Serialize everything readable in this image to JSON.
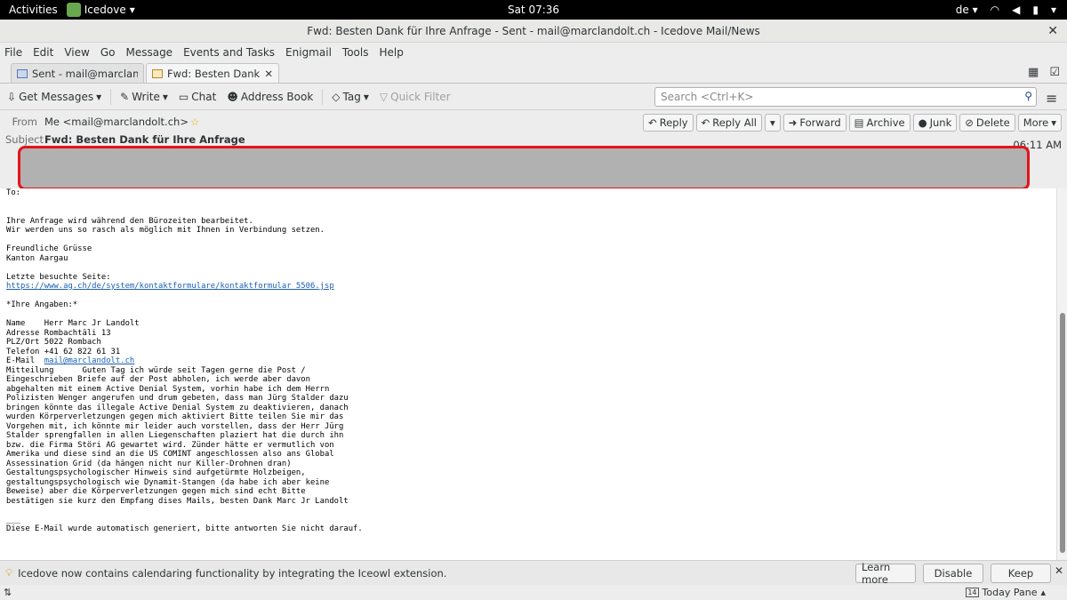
{
  "topbar": {
    "activities": "Activities",
    "app_name": "Icedove",
    "clock": "Sat 07:36",
    "lang": "de"
  },
  "window": {
    "title": "Fwd: Besten Dank für Ihre Anfrage - Sent - mail@marclandolt.ch - Icedove Mail/News"
  },
  "menu": [
    "File",
    "Edit",
    "View",
    "Go",
    "Message",
    "Events and Tasks",
    "Enigmail",
    "Tools",
    "Help"
  ],
  "tabs": [
    {
      "label": "Sent - mail@marclandol..."
    },
    {
      "label": "Fwd: Besten Dank für..."
    }
  ],
  "toolbar": {
    "get_messages": "Get Messages",
    "write": "Write",
    "chat": "Chat",
    "address_book": "Address Book",
    "tag": "Tag",
    "quick_filter": "Quick Filter",
    "search_placeholder": "Search <Ctrl+K>"
  },
  "header": {
    "from_label": "From",
    "from_value": "Me <mail@marclandolt.ch>",
    "subject_label": "Subject",
    "subject_value": "Fwd: Besten Dank für Ihre Anfrage",
    "time": "06:11 AM",
    "buttons": {
      "reply": "Reply",
      "reply_all": "Reply All",
      "forward": "Forward",
      "archive": "Archive",
      "junk": "Junk",
      "delete": "Delete",
      "more": "More"
    }
  },
  "body": {
    "to_label": "To:",
    "l1": "Ihre Anfrage wird während den Bürozeiten bearbeitet.",
    "l2": "Wir werden uns so rasch als möglich mit Ihnen in Verbindung setzen.",
    "l3": "Freundliche Grüsse",
    "l4": "Kanton Aargau",
    "l5": "Letzte besuchte Seite:",
    "link1": "https://www.ag.ch/de/system/kontaktformulare/kontaktformular_5506.jsp",
    "l6": "*Ihre Angaben:*",
    "name": "Name    Herr Marc Jr Landolt",
    "adresse": "Adresse Rombachtäli 13",
    "plz": "PLZ/Ort 5022 Rombach",
    "telefon": "Telefon +41 62 822 61 31",
    "email_label": "E-Mail  ",
    "email_link": "mail@marclandolt.ch",
    "m1": "Mitteilung      Guten Tag ich würde seit Tagen gerne die Post /",
    "m2": "Eingeschrieben Briefe auf der Post abholen, ich werde aber davon",
    "m3": "abgehalten mit einem Active Denial System, vorhin habe ich dem Herrn",
    "m4": "Polizisten Wenger angerufen und drum gebeten, dass man Jürg Stalder dazu",
    "m5": "bringen könnte das illegale Active Denial System zu deaktivieren, danach",
    "m6": "wurden Körperverletzungen gegen mich aktiviert Bitte teilen Sie mir das",
    "m7": "Vorgehen mit, ich könnte mir leider auch vorstellen, dass der Herr Jürg",
    "m8": "Stalder sprengfallen in allen Liegenschaften plaziert hat die durch ihn",
    "m9": "bzw. die Firma Störi AG gewartet wird. Zünder hätte er vermutlich von",
    "m10": "Amerika und diese sind an die US COMINT angeschlossen also ans Global",
    "m11": "Assessination Grid (da hängen nicht nur Killer-Drohnen dran)",
    "m12": "Gestaltungspsychologischer Hinweis sind aufgetürmte Holzbeigen,",
    "m13": "gestaltungspsychologisch wie Dynamit-Stangen (da habe ich aber keine",
    "m14": "Beweise) aber die Körperverletzungen gegen mich sind echt Bitte",
    "m15": "bestätigen sie kurz den Empfang dises Mails, besten Dank Marc Jr Landolt",
    "sig": "___",
    "footer": "Diese E-Mail wurde automatisch generiert, bitte antworten Sie nicht darauf."
  },
  "notification": {
    "text": "Icedove now contains calendaring functionality by integrating the Iceowl extension.",
    "learn_more": "Learn more",
    "disable": "Disable",
    "keep": "Keep"
  },
  "status": {
    "today_pane": "Today Pane",
    "today_day": "14"
  }
}
